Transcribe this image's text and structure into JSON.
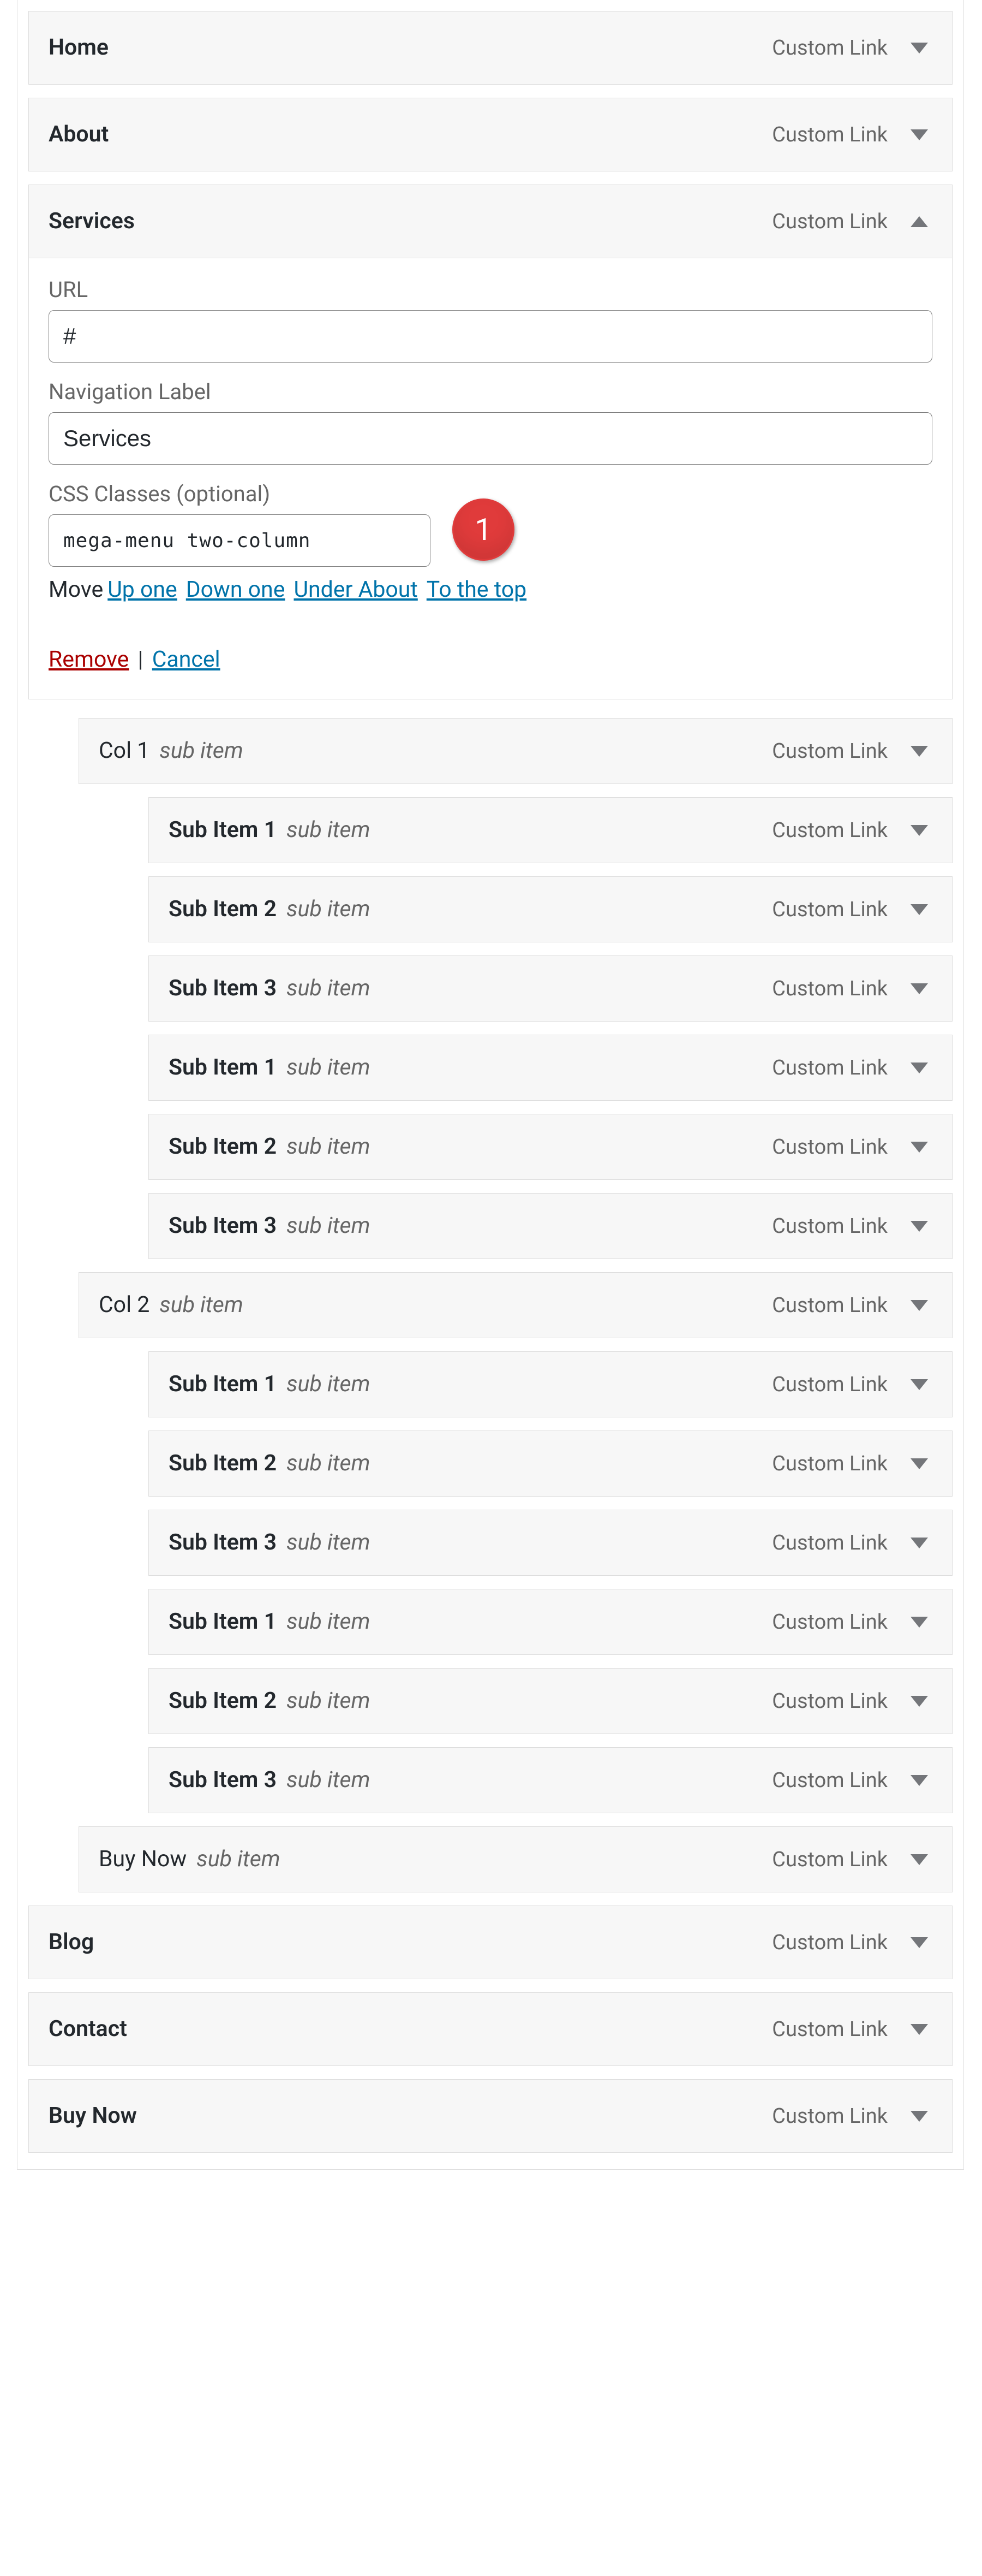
{
  "typeLabel": "Custom Link",
  "annotation": {
    "number": "1"
  },
  "settings": {
    "urlLabel": "URL",
    "urlValue": "#",
    "navLabel": "Navigation Label",
    "navValue": "Services",
    "cssLabel": "CSS Classes (optional)",
    "cssValue": "mega-menu two-column",
    "moveLabel": "Move",
    "upOne": "Up one",
    "downOne": "Down one",
    "underAbout": "Under About",
    "toTop": "To the top",
    "remove": "Remove",
    "cancel": "Cancel"
  },
  "items": [
    {
      "title": "Home",
      "sub": "",
      "depth": 0,
      "expanded": false,
      "large": true
    },
    {
      "title": "About",
      "sub": "",
      "depth": 0,
      "expanded": false,
      "large": true
    },
    {
      "title": "Services",
      "sub": "",
      "depth": 0,
      "expanded": true,
      "large": true
    },
    {
      "title": "Col 1",
      "sub": "sub item",
      "depth": 1,
      "expanded": false,
      "large": false,
      "thinTitle": true
    },
    {
      "title": "Sub Item 1",
      "sub": "sub item",
      "depth": 2,
      "expanded": false,
      "large": false
    },
    {
      "title": "Sub Item 2",
      "sub": "sub item",
      "depth": 2,
      "expanded": false,
      "large": false
    },
    {
      "title": "Sub Item 3",
      "sub": "sub item",
      "depth": 2,
      "expanded": false,
      "large": false
    },
    {
      "title": "Sub Item 1",
      "sub": "sub item",
      "depth": 2,
      "expanded": false,
      "large": false
    },
    {
      "title": "Sub Item 2",
      "sub": "sub item",
      "depth": 2,
      "expanded": false,
      "large": false
    },
    {
      "title": "Sub Item 3",
      "sub": "sub item",
      "depth": 2,
      "expanded": false,
      "large": false
    },
    {
      "title": "Col 2",
      "sub": "sub item",
      "depth": 1,
      "expanded": false,
      "large": false,
      "thinTitle": true
    },
    {
      "title": "Sub Item 1",
      "sub": "sub item",
      "depth": 2,
      "expanded": false,
      "large": false
    },
    {
      "title": "Sub Item 2",
      "sub": "sub item",
      "depth": 2,
      "expanded": false,
      "large": false
    },
    {
      "title": "Sub Item 3",
      "sub": "sub item",
      "depth": 2,
      "expanded": false,
      "large": false
    },
    {
      "title": "Sub Item 1",
      "sub": "sub item",
      "depth": 2,
      "expanded": false,
      "large": false
    },
    {
      "title": "Sub Item 2",
      "sub": "sub item",
      "depth": 2,
      "expanded": false,
      "large": false
    },
    {
      "title": "Sub Item 3",
      "sub": "sub item",
      "depth": 2,
      "expanded": false,
      "large": false
    },
    {
      "title": "Buy Now",
      "sub": "sub item",
      "depth": 1,
      "expanded": false,
      "large": false,
      "thinTitle": true
    },
    {
      "title": "Blog",
      "sub": "",
      "depth": 0,
      "expanded": false,
      "large": true
    },
    {
      "title": "Contact",
      "sub": "",
      "depth": 0,
      "expanded": false,
      "large": true
    },
    {
      "title": "Buy Now",
      "sub": "",
      "depth": 0,
      "expanded": false,
      "large": true
    }
  ]
}
